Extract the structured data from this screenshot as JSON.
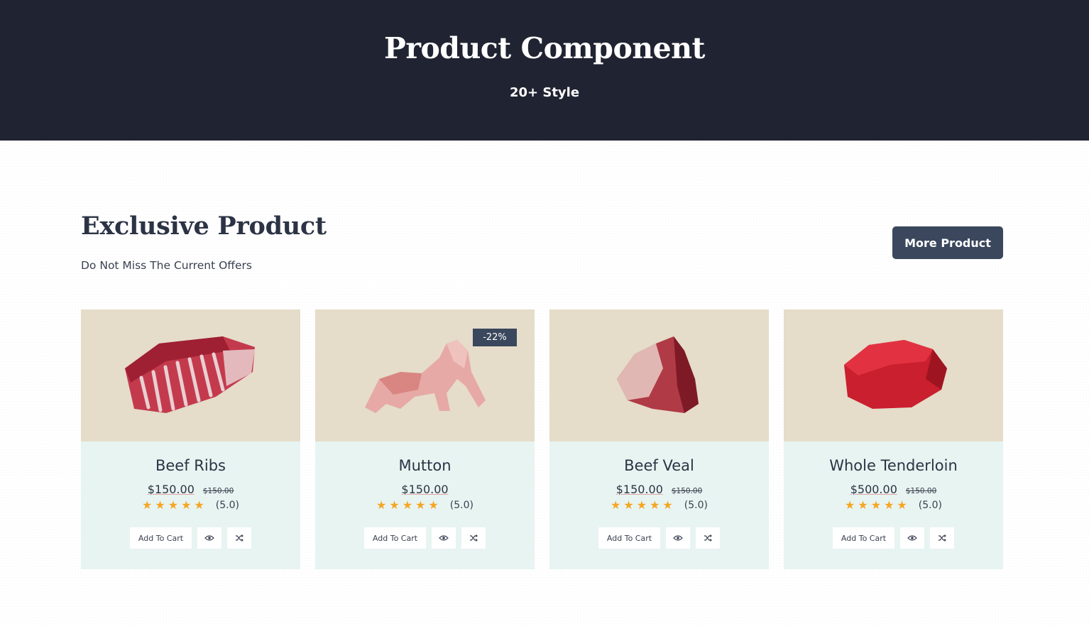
{
  "hero": {
    "title": "Product Component",
    "subtitle": "20+ Style"
  },
  "section": {
    "title": "Exclusive Product",
    "subtitle": "Do Not Miss The Current Offers",
    "more_label": "More Product"
  },
  "colors": {
    "hero_bg": "#202331",
    "accent": "#3a475c",
    "image_bg": "#e5dcc9",
    "card_bg": "#e7f4f1",
    "star": "#f5a623"
  },
  "products": [
    {
      "name": "Beef Ribs",
      "price": "$150.00",
      "old_price": "$150.00",
      "rating": "(5.0)",
      "stars": "★★★★★",
      "cart_label": "Add To Cart",
      "badge": "",
      "image": "beef-ribs-image"
    },
    {
      "name": "Mutton",
      "price": "$150.00",
      "old_price": "",
      "rating": "(5.0)",
      "stars": "★★★★★",
      "cart_label": "Add To Cart",
      "badge": "-22%",
      "image": "mutton-image"
    },
    {
      "name": "Beef Veal",
      "price": "$150.00",
      "old_price": "$150.00",
      "rating": "(5.0)",
      "stars": "★★★★★",
      "cart_label": "Add To Cart",
      "badge": "",
      "image": "beef-veal-image"
    },
    {
      "name": "Whole Tenderloin",
      "price": "$500.00",
      "old_price": "$150.00",
      "rating": "(5.0)",
      "stars": "★★★★★",
      "cart_label": "Add To Cart",
      "badge": "",
      "image": "tenderloin-image"
    }
  ]
}
